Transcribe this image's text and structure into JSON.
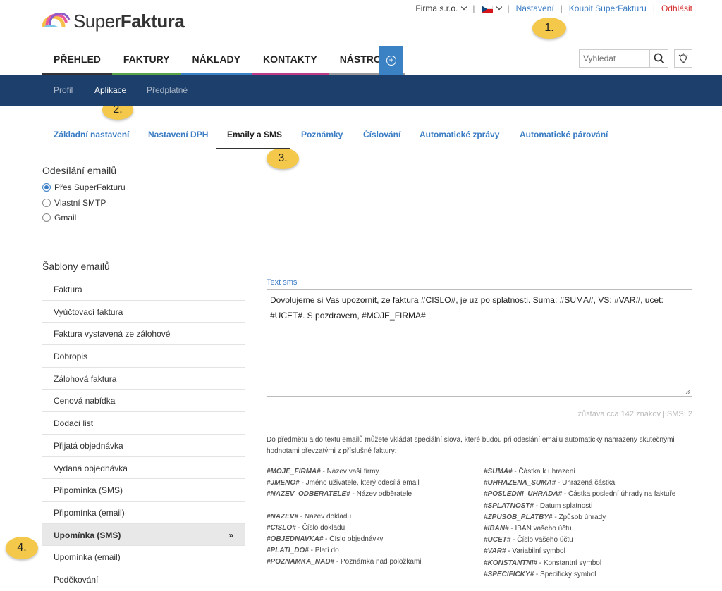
{
  "brand": {
    "name_light": "Super",
    "name_bold": "Faktura"
  },
  "topnav": {
    "company": "Firma s.r.o.",
    "settings": "Nastavení",
    "buy": "Koupit SuperFakturu",
    "logout": "Odhlásit"
  },
  "badges": {
    "b1": "1.",
    "b2": "2.",
    "b3": "3.",
    "b4": "4."
  },
  "mainnav": [
    {
      "label": "PŘEHLED",
      "color": "#333333"
    },
    {
      "label": "FAKTURY",
      "color": "#5aa346"
    },
    {
      "label": "NÁKLADY",
      "color": "#3b82c4"
    },
    {
      "label": "KONTAKTY",
      "color": "#c03a8a"
    },
    {
      "label": "NÁSTROJE",
      "color": "#999999"
    }
  ],
  "search": {
    "placeholder": "Vyhledat"
  },
  "subnav": [
    "Profil",
    "Aplikace",
    "Předplatné"
  ],
  "tabs": [
    "Základní nastavení",
    "Nastavení DPH",
    "Emaily a SMS",
    "Poznámky",
    "Číslování",
    "Automatické zprávy",
    "Automatické párování"
  ],
  "sending": {
    "title": "Odesílání emailů",
    "options": [
      "Přes SuperFakturu",
      "Vlastní SMTP",
      "Gmail"
    ],
    "selected": "Přes SuperFakturu"
  },
  "templates": {
    "title": "Šablony emailů",
    "items": [
      "Faktura",
      "Vyúčtovací faktura",
      "Faktura vystavená ze zálohové",
      "Dobropis",
      "Zálohová faktura",
      "Cenová nabídka",
      "Dodací list",
      "Přijatá objednávka",
      "Vydaná objednávka",
      "Připomínka (SMS)",
      "Připomínka (email)",
      "Upomínka (SMS)",
      "Upomínka (email)",
      "Poděkování"
    ],
    "active": "Upomínka (SMS)",
    "active_arrow": "»"
  },
  "sms": {
    "label": "Text sms",
    "text": "Dovolujeme si Vas upozornit, ze faktura #CISLO#, je uz po splatnosti. Suma: #SUMA#, VS: #VAR#, ucet: #UCET#. S pozdravem, #MOJE_FIRMA#",
    "counter": "zůstáva cca 142 znakov | SMS: 2"
  },
  "help": "Do předmětu a do textu emailů můžete vkládat speciální slova, které budou při odeslání emailu automaticky nahrazeny skutečnými hodnotami převzatými z příslušné faktury:",
  "vars_left": [
    {
      "k": "#MOJE_FIRMA#",
      "d": " - Název vaší firmy"
    },
    {
      "k": "#JMENO#",
      "d": " - Jméno uživatele, který odesílá email"
    },
    {
      "k": "#NAZEV_ODBERATELE#",
      "d": " - Název odběratele"
    },
    {
      "k": "#NAZEV#",
      "d": " - Název dokladu"
    },
    {
      "k": "#CISLO#",
      "d": " - Číslo dokladu"
    },
    {
      "k": "#OBJEDNAVKA#",
      "d": " - Číslo objednávky"
    },
    {
      "k": "#PLATI_DO#",
      "d": " - Platí do"
    },
    {
      "k": "#POZNAMKA_NAD#",
      "d": " - Poznámka nad položkami"
    }
  ],
  "vars_right": [
    {
      "k": "#SUMA#",
      "d": " - Částka k uhrazení"
    },
    {
      "k": "#UHRAZENA_SUMA#",
      "d": " - Uhrazená částka"
    },
    {
      "k": "#POSLEDNI_UHRADA#",
      "d": " - Částka poslední úhrady na faktuře"
    },
    {
      "k": "#SPLATNOST#",
      "d": " - Datum splatnosti"
    },
    {
      "k": "#ZPUSOB_PLATBY#",
      "d": " - Způsob úhrady"
    },
    {
      "k": "#IBAN#",
      "d": " - IBAN vašeho účtu"
    },
    {
      "k": "#UCET#",
      "d": " - Číslo vašeho účtu"
    },
    {
      "k": "#VAR#",
      "d": " - Variabilní symbol"
    },
    {
      "k": "#KONSTANTNI#",
      "d": " - Konstantní symbol"
    },
    {
      "k": "#SPECIFICKY#",
      "d": " - Specifický symbol"
    }
  ]
}
